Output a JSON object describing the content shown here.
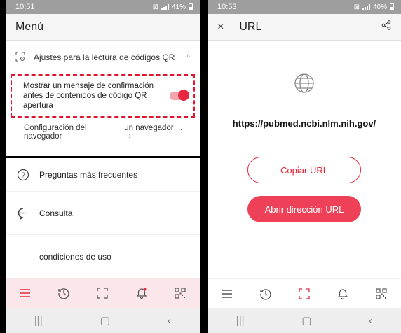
{
  "left": {
    "status": {
      "time": "10:51",
      "battery": "41%"
    },
    "appbar": {
      "title": "Menú"
    },
    "section": {
      "label": "Ajustes para la lectura de códigos QR"
    },
    "confirm": {
      "text": "Mostrar un mensaje de confirmación antes de contenidos de código QR apertura",
      "enabled": true
    },
    "browser": {
      "label": "Configuración del navegador",
      "value": "un navegador ..."
    },
    "items": [
      {
        "label": "Preguntas más frecuentes",
        "icon": "help-circle-icon"
      },
      {
        "label": "Consulta",
        "icon": "chat-icon"
      },
      {
        "label": "condiciones de uso",
        "icon": ""
      }
    ]
  },
  "right": {
    "status": {
      "time": "10:53",
      "battery": "40%"
    },
    "appbar": {
      "title": "URL"
    },
    "url": "https://pubmed.ncbi.nlm.nih.gov/",
    "copy_label": "Copiar URL",
    "open_label": "Abrir dirección URL"
  },
  "colors": {
    "accent": "#e8283e",
    "nav_active_bg": "#fbe7e9",
    "status_bar": "#9e9e9e"
  }
}
